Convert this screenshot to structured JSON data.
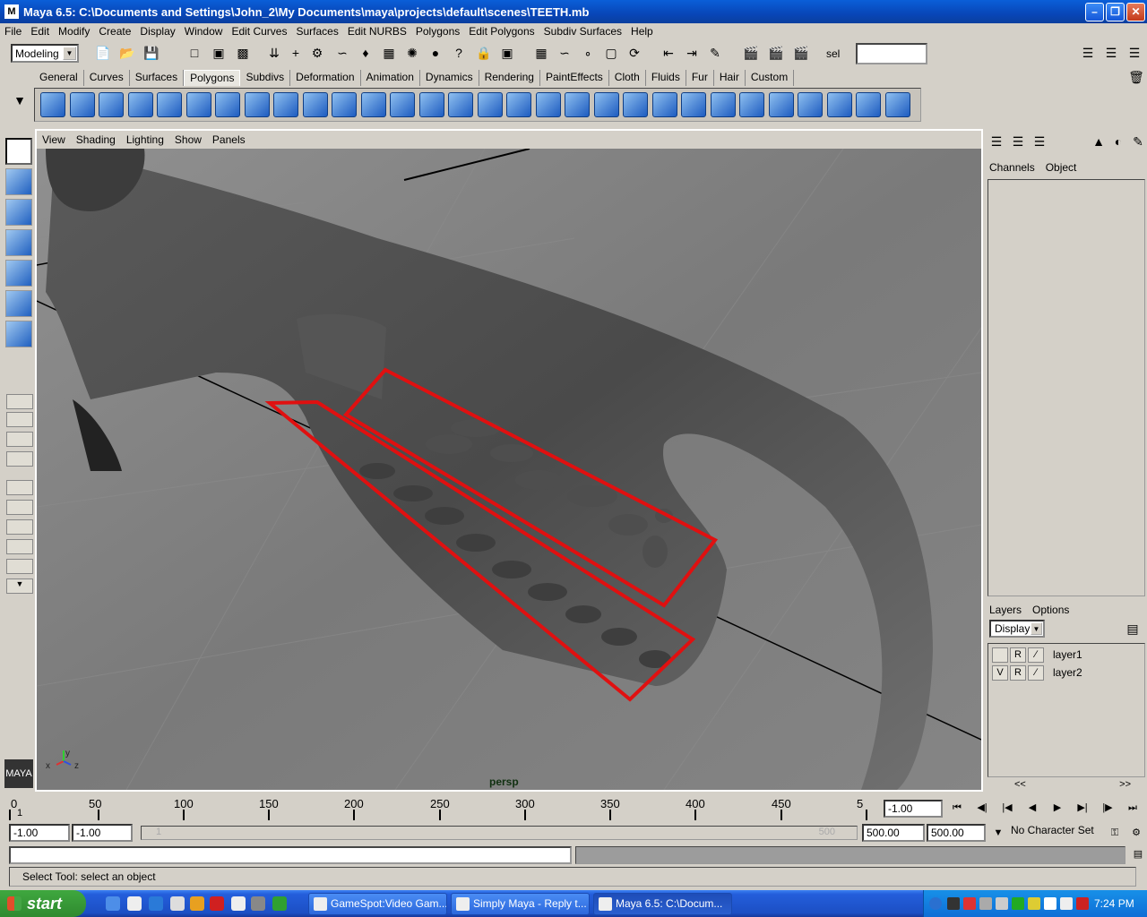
{
  "window": {
    "title": "Maya 6.5: C:\\Documents and Settings\\John_2\\My Documents\\maya\\projects\\default\\scenes\\TEETH.mb",
    "icon": "maya-app-icon",
    "controls": [
      "minimize-icon",
      "maximize-icon",
      "close-icon"
    ]
  },
  "menubar": [
    "File",
    "Edit",
    "Modify",
    "Create",
    "Display",
    "Window",
    "Edit Curves",
    "Surfaces",
    "Edit NURBS",
    "Polygons",
    "Edit Polygons",
    "Subdiv Surfaces",
    "Help"
  ],
  "statusline": {
    "mode": "Modeling",
    "sel_label": "sel",
    "sel_value": ""
  },
  "shelf": {
    "tabs": [
      "General",
      "Curves",
      "Surfaces",
      "Polygons",
      "Subdivs",
      "Deformation",
      "Animation",
      "Dynamics",
      "Rendering",
      "PaintEffects",
      "Cloth",
      "Fluids",
      "Fur",
      "Hair",
      "Custom"
    ],
    "active_tab": "Polygons",
    "icons": [
      "poly-soccer-ball-icon",
      "poly-cube-icon",
      "poly-cylinder-icon",
      "poly-cone-icon",
      "poly-plane-icon",
      "poly-torus-icon",
      "poly-pipe-icon",
      "combine-icon",
      "separate-icon",
      "smooth-icon",
      "boolean-icon",
      "subdiv-proxy-icon",
      "extrude-face-icon",
      "split-polygon-icon",
      "extrude-edge-icon",
      "wedge-face-icon",
      "chamfer-vertex-icon",
      "bevel-icon",
      "append-polygon-icon",
      "merge-vertices-icon",
      "cut-faces-icon",
      "triangulate-icon",
      "quadrangulate-icon",
      "collapse-icon",
      "planar-mapping-icon",
      "cylindrical-mapping-icon",
      "spherical-mapping-icon",
      "automatic-mapping-icon",
      "uv-texture-editor-icon",
      "checker-icon"
    ]
  },
  "viewport": {
    "menus": [
      "View",
      "Shading",
      "Lighting",
      "Show",
      "Panels"
    ],
    "camera_label": "persp",
    "axis_labels": {
      "x": "x",
      "y": "y",
      "z": "z"
    },
    "background": "#7a7a7a",
    "selection_color": "#e01010"
  },
  "right_panel": {
    "channel_tabs": [
      "Channels",
      "Object"
    ],
    "layers_menu": [
      "Layers",
      "Options"
    ],
    "layer_mode": "Display",
    "layers": [
      {
        "visible": "",
        "ref": "R",
        "name": "layer1"
      },
      {
        "visible": "V",
        "ref": "R",
        "name": "layer2"
      }
    ],
    "nav_left": "<<",
    "nav_right": ">>"
  },
  "timeline": {
    "ticks": [
      "0",
      "50",
      "100",
      "150",
      "200",
      "250",
      "300",
      "350",
      "400",
      "450",
      "5"
    ],
    "current_frame": "-1.00",
    "first_tick": "1"
  },
  "range": {
    "start_time": "-1.00",
    "playback_start": "-1.00",
    "slider_start": "1",
    "slider_end": "500",
    "playback_end": "500.00",
    "end_time": "500.00",
    "character_set": "No Character Set"
  },
  "help_line": "Select Tool: select an object",
  "taskbar": {
    "start": "start",
    "buttons": [
      "GameSpot:Video Gam...",
      "Simply Maya - Reply t...",
      "Maya 6.5: C:\\Docum..."
    ],
    "active_button": 2,
    "clock": "7:24 PM"
  }
}
